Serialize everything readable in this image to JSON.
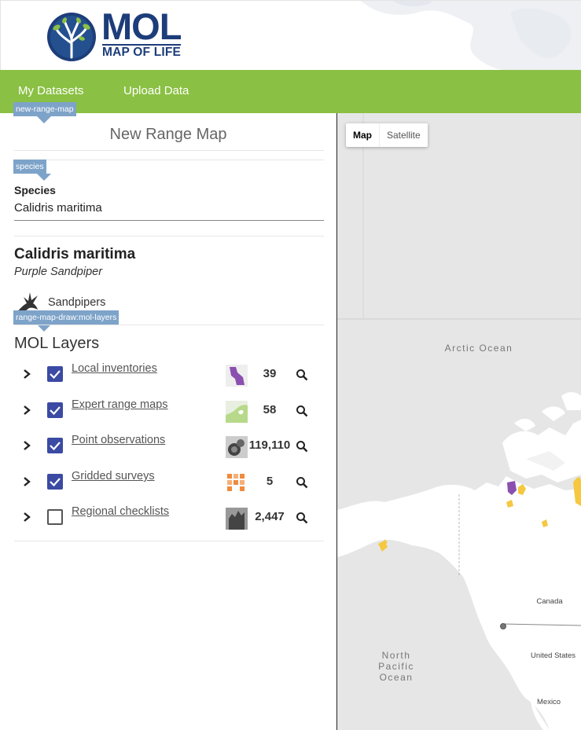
{
  "brand": {
    "logo_main": "MOL",
    "logo_sub": "MAP OF LIFE"
  },
  "nav": {
    "items": [
      "My Datasets",
      "Upload Data"
    ]
  },
  "tags": {
    "new_range_map": "new-range-map",
    "species": "species",
    "mol_layers": "range-map-draw:mol-layers"
  },
  "panel": {
    "title": "New Range Map",
    "species_label": "Species",
    "species_value": "Calidris maritima",
    "scientific_name": "Calidris maritima",
    "common_name": "Purple Sandpiper",
    "group_name": "Sandpipers",
    "group_icon": "sandpiper-icon",
    "layers_title": "MOL Layers"
  },
  "layers": [
    {
      "name": "Local inventories",
      "checked": true,
      "count": "39",
      "thumb": "local-inventories-thumb"
    },
    {
      "name": "Expert range maps",
      "checked": true,
      "count": "58",
      "thumb": "expert-range-thumb"
    },
    {
      "name": "Point observations",
      "checked": true,
      "count": "119,110",
      "thumb": "point-observations-thumb"
    },
    {
      "name": "Gridded surveys",
      "checked": true,
      "count": "5",
      "thumb": "gridded-surveys-thumb"
    },
    {
      "name": "Regional checklists",
      "checked": false,
      "count": "2,447",
      "thumb": "regional-checklists-thumb"
    }
  ],
  "map": {
    "toggle": [
      "Map",
      "Satellite"
    ],
    "active": "Map",
    "labels": {
      "arctic": "Arctic Ocean",
      "pacific_1": "North",
      "pacific_2": "Pacific",
      "pacific_3": "Ocean",
      "canada": "Canada",
      "us": "United States",
      "mexico": "Mexico"
    }
  },
  "colors": {
    "nav": "#8ac043",
    "brand": "#1d3d7a",
    "checkbox": "#3b4aa3",
    "tag": "#7ea3c9",
    "occurrence_yellow": "#f5c840",
    "range_purple": "#8b4fb0"
  }
}
